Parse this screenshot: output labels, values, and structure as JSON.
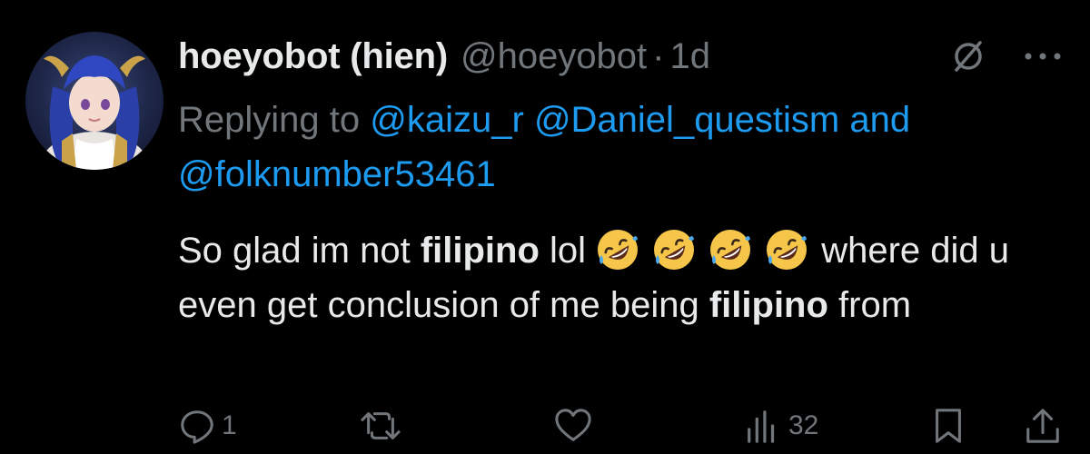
{
  "tweet": {
    "display_name": "hoeyobot (hien)",
    "handle": "@hoeyobot",
    "separator": "·",
    "time": "1d",
    "replying_prefix": "Replying to",
    "mentions": [
      "@kaizu_r",
      "@Daniel_questism",
      "@folknumber53461"
    ],
    "mentions_joiner": "and",
    "body": {
      "part1": "So glad im not",
      "bold1": "filipino",
      "part2": "lol",
      "emoji_name": "rolling-on-the-floor-laughing",
      "emoji_count": 4,
      "part3": "where did u even get conclusion of me being",
      "bold2": "filipino",
      "part4": "from"
    },
    "actions": {
      "reply_count": "1",
      "retweet_count": "",
      "like_count": "",
      "views_count": "32"
    }
  },
  "colors": {
    "background": "#000000",
    "text": "#e7e9ea",
    "muted": "#71767b",
    "link": "#1d9bf0"
  },
  "icons": [
    "grok-icon",
    "more-icon",
    "reply-icon",
    "retweet-icon",
    "like-icon",
    "views-icon",
    "bookmark-icon",
    "share-icon"
  ]
}
